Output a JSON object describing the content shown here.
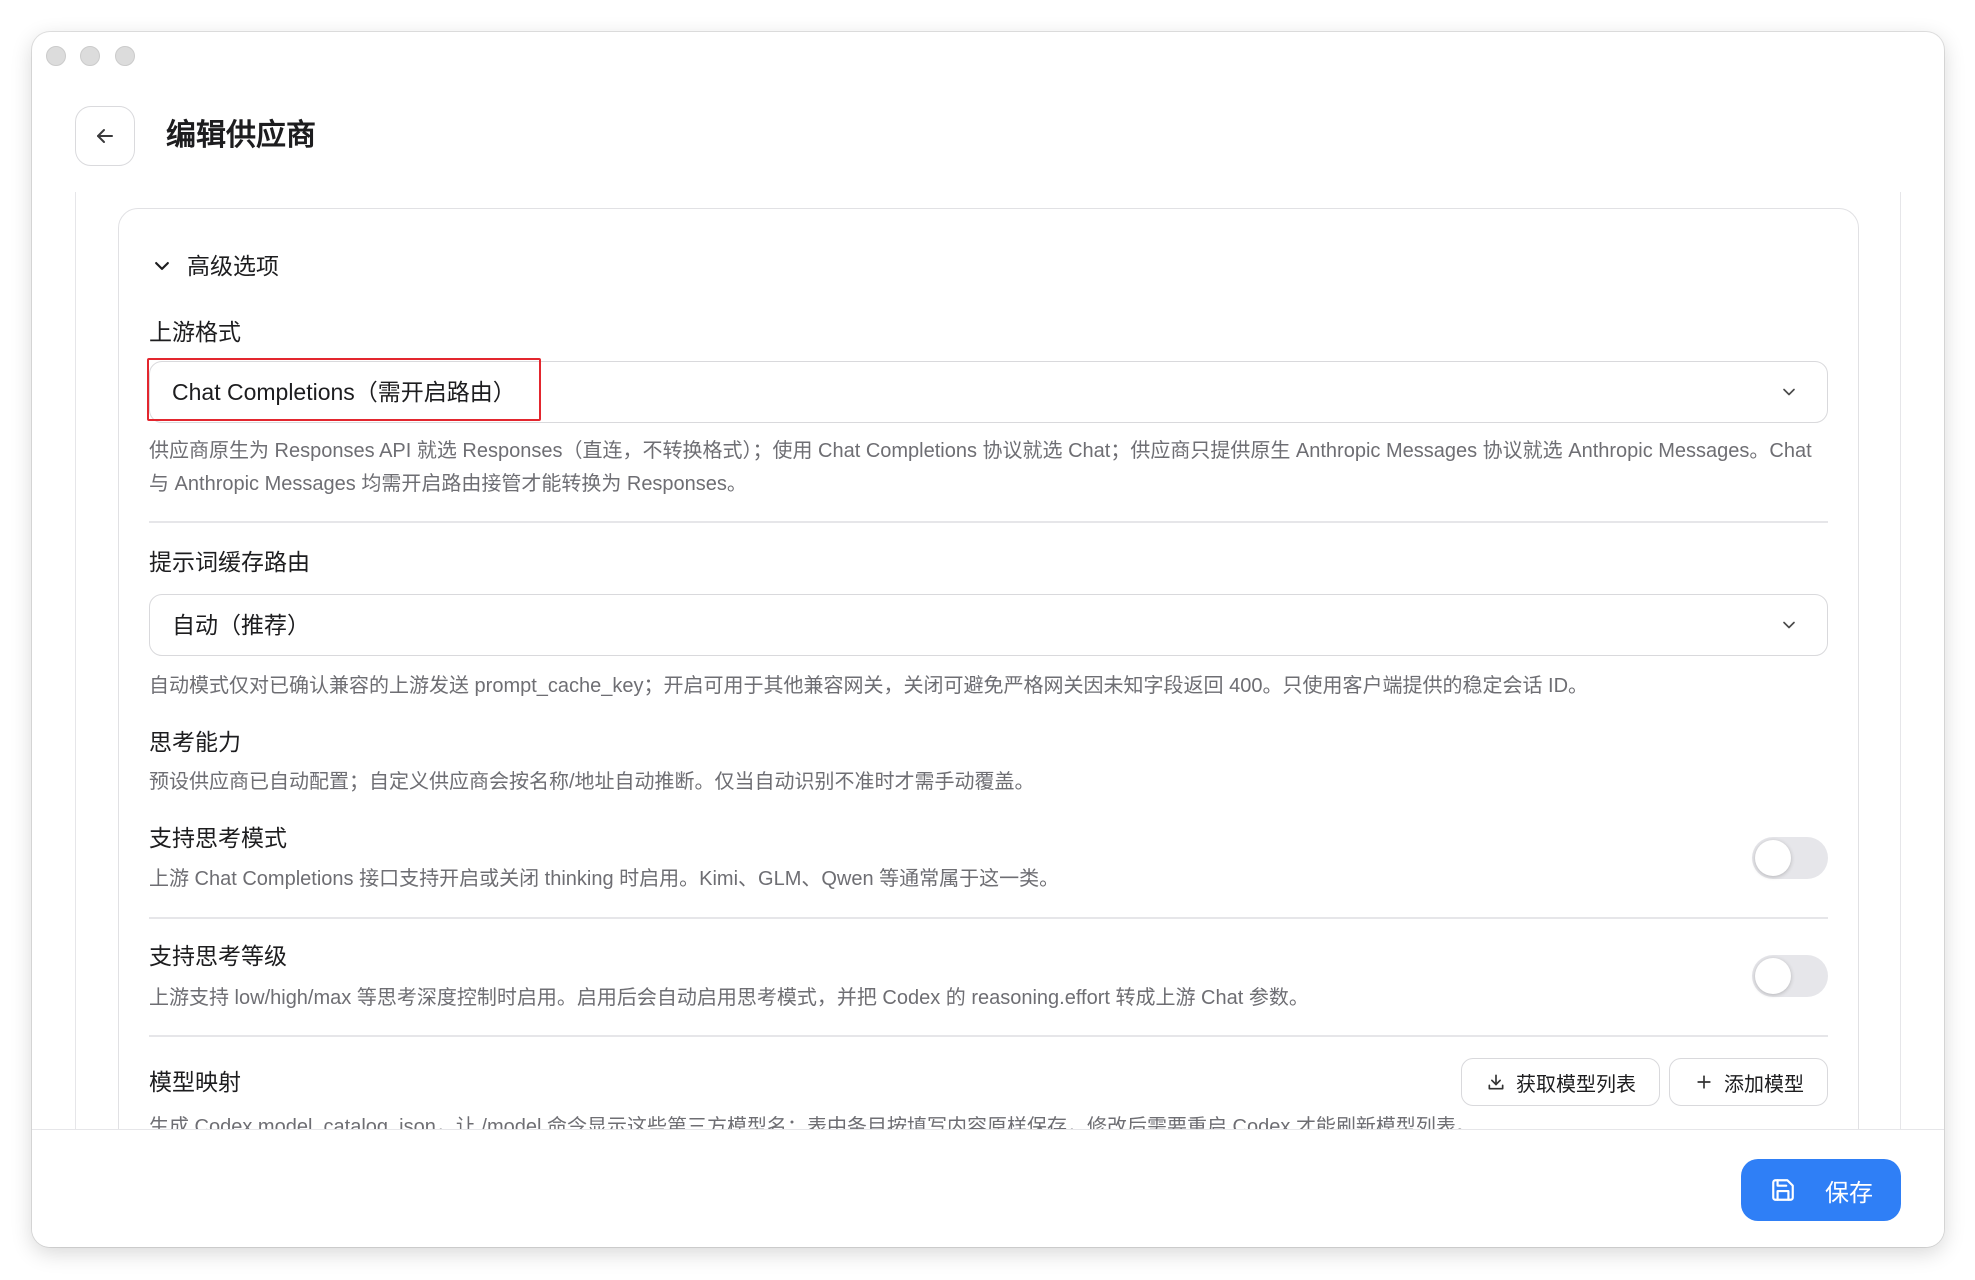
{
  "header": {
    "title": "编辑供应商",
    "back_icon": "arrow-left-icon"
  },
  "advanced": {
    "label": "高级选项",
    "icon": "chevron-down-icon",
    "expanded": true
  },
  "upstream_format": {
    "label": "上游格式",
    "selected": "Chat Completions（需开启路由）",
    "help": "供应商原生为 Responses API 就选 Responses（直连，不转换格式）；使用 Chat Completions 协议就选 Chat；供应商只提供原生 Anthropic Messages 协议就选 Anthropic Messages。Chat 与 Anthropic Messages 均需开启路由接管才能转换为 Responses。"
  },
  "prompt_cache_routing": {
    "label": "提示词缓存路由",
    "selected": "自动（推荐）",
    "help": "自动模式仅对已确认兼容的上游发送 prompt_cache_key；开启可用于其他兼容网关，关闭可避免严格网关因未知字段返回 400。只使用客户端提供的稳定会话 ID。"
  },
  "thinking": {
    "title": "思考能力",
    "help": "预设供应商已自动配置；自定义供应商会按名称/地址自动推断。仅当自动识别不准时才需手动覆盖。",
    "options": [
      {
        "label": "支持思考模式",
        "help": "上游 Chat Completions 接口支持开启或关闭 thinking 时启用。Kimi、GLM、Qwen 等通常属于这一类。",
        "enabled": false
      },
      {
        "label": "支持思考等级",
        "help": "上游支持 low/high/max 等思考深度控制时启用。启用后会自动启用思考模式，并把 Codex 的 reasoning.effort 转成上游 Chat 参数。",
        "enabled": false
      }
    ]
  },
  "model_mapping": {
    "label": "模型映射",
    "fetch_button": {
      "label": "获取模型列表",
      "icon": "download-icon"
    },
    "add_button": {
      "label": "添加模型",
      "icon": "plus-icon"
    },
    "help": "生成 Codex model_catalog_json，让 /model 命令显示这些第三方模型名；表中条目按填写内容原样保存，修改后需要重启 Codex 才能刷新模型列表。"
  },
  "footer": {
    "save_label": "保存",
    "save_icon": "save-icon"
  },
  "colors": {
    "accent": "#2f7ff6",
    "highlight": "#e3262e",
    "muted": "#6e6e73"
  }
}
